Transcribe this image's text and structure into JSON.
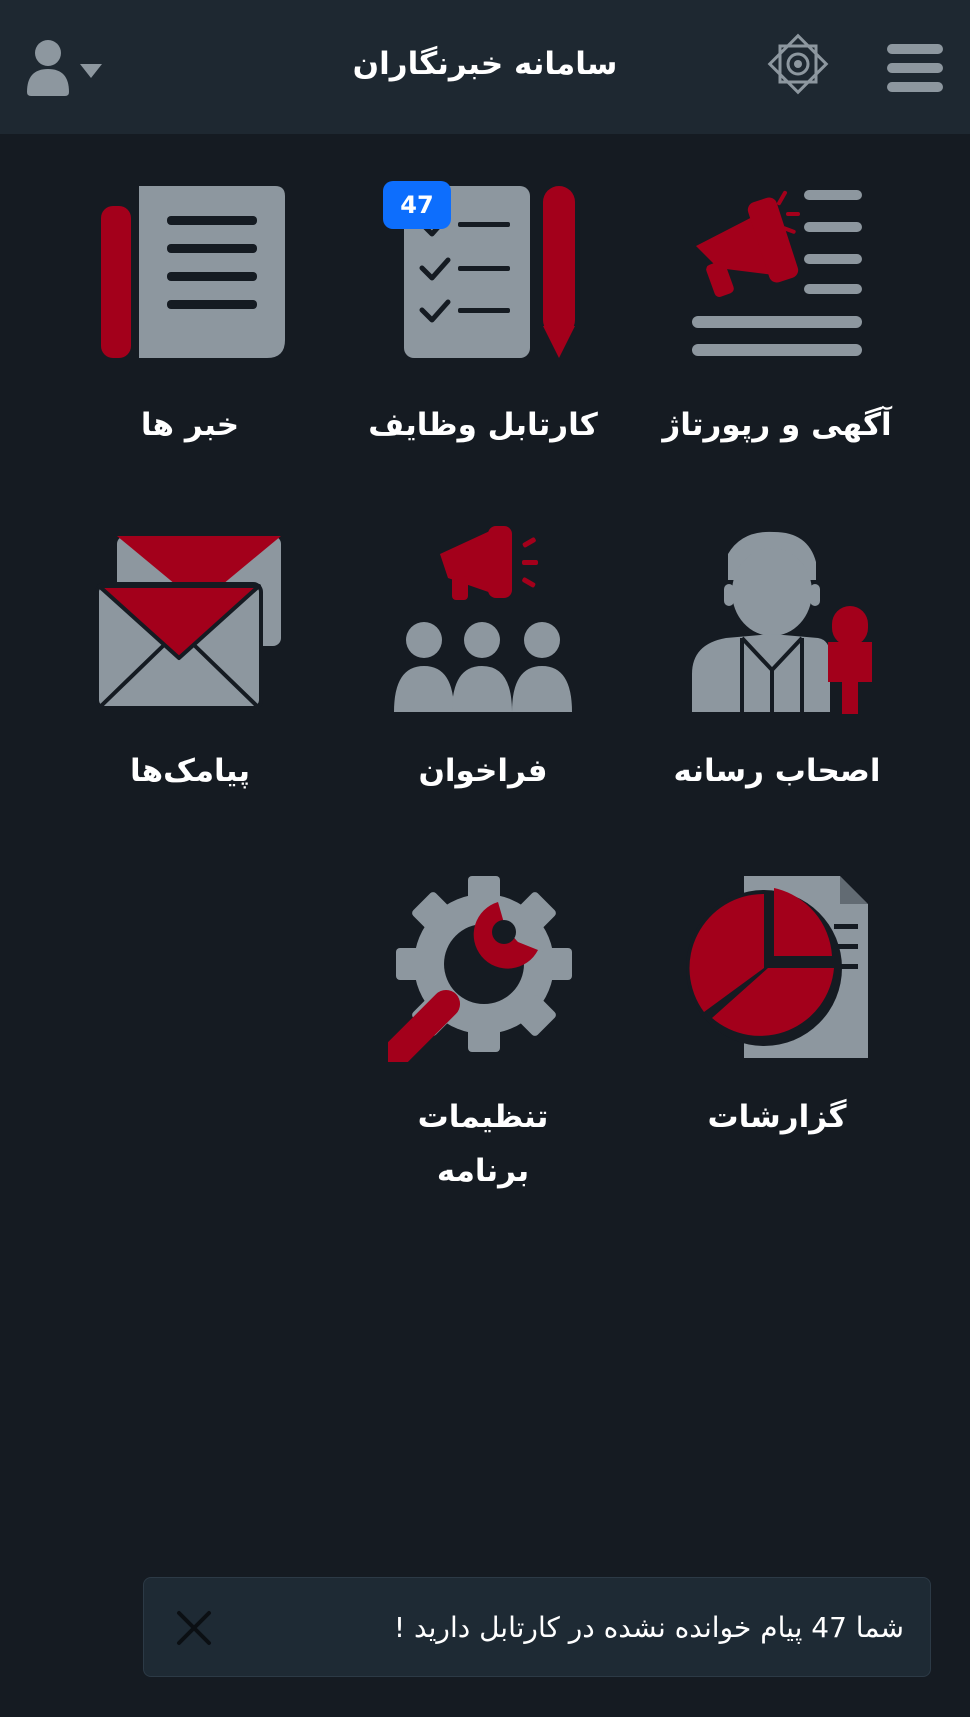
{
  "header": {
    "title": "سامانه خبرنگاران",
    "menu_icon": "hamburger-menu-icon",
    "logo_icon": "emblem-logo",
    "user_icon": "user-account-icon"
  },
  "tiles": [
    {
      "label": "آگهی و رپورتاژ",
      "icon": "megaphone-document-icon"
    },
    {
      "label": "کارتابل وظایف",
      "icon": "checklist-pencil-icon",
      "badge": "47"
    },
    {
      "label": "خبر ها",
      "icon": "newspaper-icon"
    },
    {
      "label": "اصحاب رسانه",
      "icon": "reporter-microphone-icon"
    },
    {
      "label": "فراخوان",
      "icon": "announcement-crowd-icon"
    },
    {
      "label": "پیامک‌ها",
      "icon": "envelopes-icon"
    },
    {
      "label": "گزارشات",
      "icon": "pie-chart-report-icon"
    },
    {
      "label_line1": "تنظیمات",
      "label_line2": "برنامه",
      "icon": "settings-wrench-gear-icon"
    }
  ],
  "toast": {
    "message": "شما 47 پیام خوانده نشده در کارتابل دارید !",
    "close_icon": "close-icon"
  },
  "colors": {
    "background": "#151b22",
    "header": "#1e2831",
    "icon_gray": "#8d979f",
    "accent_red": "#a3001b",
    "badge_blue": "#0d6efd"
  }
}
